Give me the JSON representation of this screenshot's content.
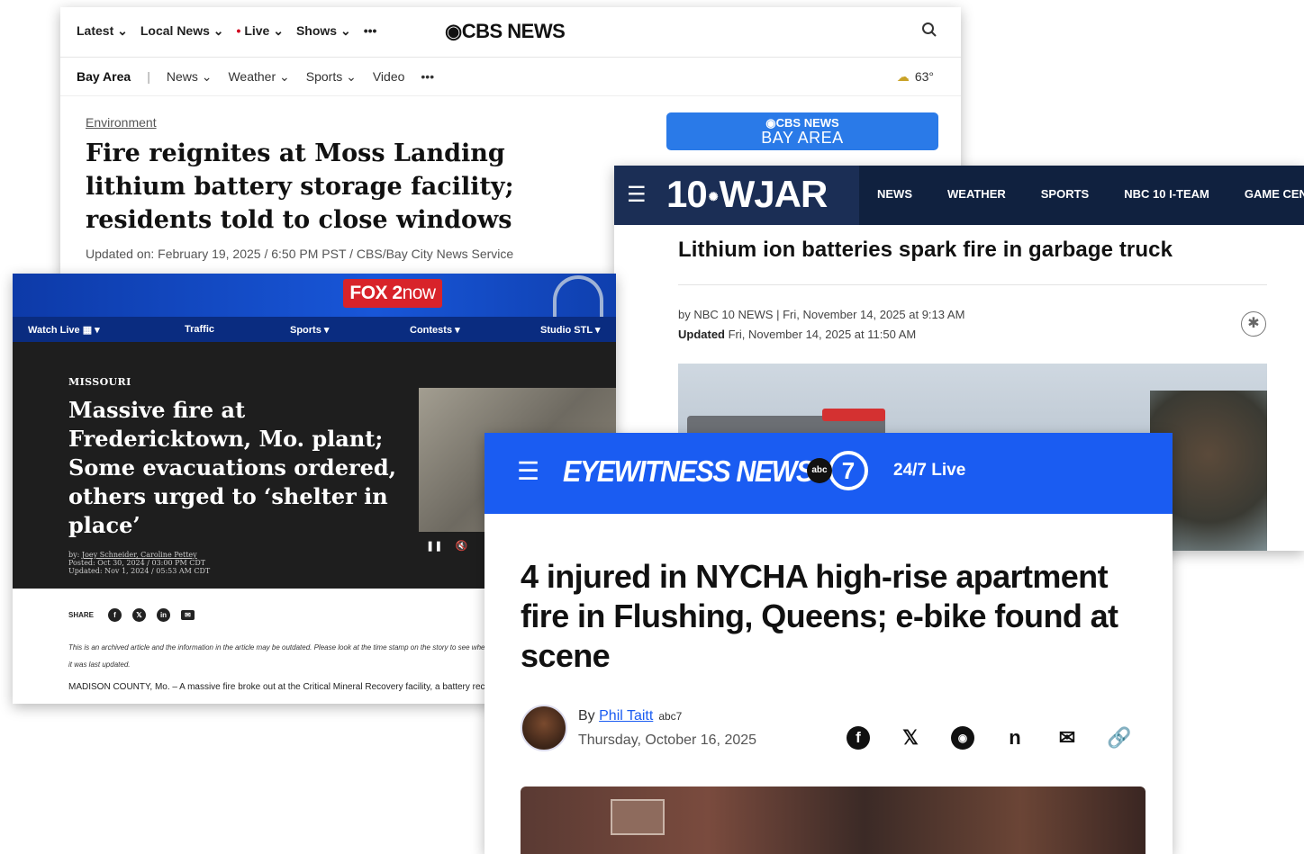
{
  "cbs": {
    "top_nav": [
      "Latest ⌄",
      "Local News ⌄",
      "Live ⌄",
      "Shows ⌄",
      "•••"
    ],
    "logo": "◉CBS NEWS",
    "search_icon": "search-icon",
    "region": "Bay Area",
    "divider": "|",
    "sub_nav": [
      "News ⌄",
      "Weather ⌄",
      "Sports ⌄",
      "Video",
      "•••"
    ],
    "weather_temp": "63°",
    "section": "Environment",
    "headline": "Fire reignites at Moss Landing lithium battery storage facility; residents told to close windows",
    "meta": "Updated on: February 19, 2025 / 6:50 PM PST / CBS/Bay City News Service",
    "promo_line1": "◉CBS NEWS",
    "promo_line2": "BAY AREA",
    "accent": "#2a7ae8"
  },
  "wjar": {
    "logo_num": "10",
    "logo_name": "WJAR",
    "nav": [
      "NEWS",
      "WEATHER",
      "SPORTS",
      "NBC 10 I-TEAM",
      "GAME CENT"
    ],
    "headline": "Lithium ion batteries spark fire in garbage truck",
    "byline": "by NBC 10 NEWS | Fri, November 14, 2025 at 9:13 AM",
    "updated_label": "Updated",
    "updated_value": " Fri, November 14, 2025 at 11:50 AM",
    "bar_color": "#10213f"
  },
  "fox": {
    "logo_fox": "FOX 2",
    "logo_now": "now",
    "nav": [
      "Watch Live ▦ ▾",
      "Traffic",
      "Sports ▾",
      "Contests ▾",
      "Studio STL ▾"
    ],
    "kicker": "MISSOURI",
    "headline": "Massive fire at Fredericktown, Mo. plant; Some evacuations ordered, others urged to ‘shelter in place’",
    "by_label": "by: ",
    "authors": "Joey Schneider, Caroline Pettey",
    "posted": "Posted: Oct 30, 2024 / 03:00 PM CDT",
    "updated": "Updated: Nov 1, 2024 / 05:53 AM CDT",
    "video_controls": [
      "❚❚",
      "🔇"
    ],
    "share_label": "SHARE",
    "share_icons": [
      "f",
      "𝕏",
      "in",
      "✉"
    ],
    "archive_note": "This is an archived article and the information in the article may be outdated. Please look at the time stamp on the story to see when it was last updated.",
    "lede": "MADISON COUNTY, Mo. – A massive fire broke out at the Critical Mineral Recovery facility, a battery recycling plant"
  },
  "abc": {
    "logo": "EYEWITNESS NEWS",
    "badge": "abc",
    "seven": "7",
    "live": "24/7 Live",
    "headline": "4 injured in NYCHA high-rise apartment fire in Flushing, Queens; e-bike found at scene",
    "by_label": "By ",
    "author": "Phil Taitt",
    "author_badge": "abc7",
    "date": "Thursday, October 16, 2025",
    "share_icons": [
      "f",
      "𝕏",
      "◉",
      "n",
      "✉",
      "🔗"
    ],
    "bar_color": "#1a5cf2"
  }
}
